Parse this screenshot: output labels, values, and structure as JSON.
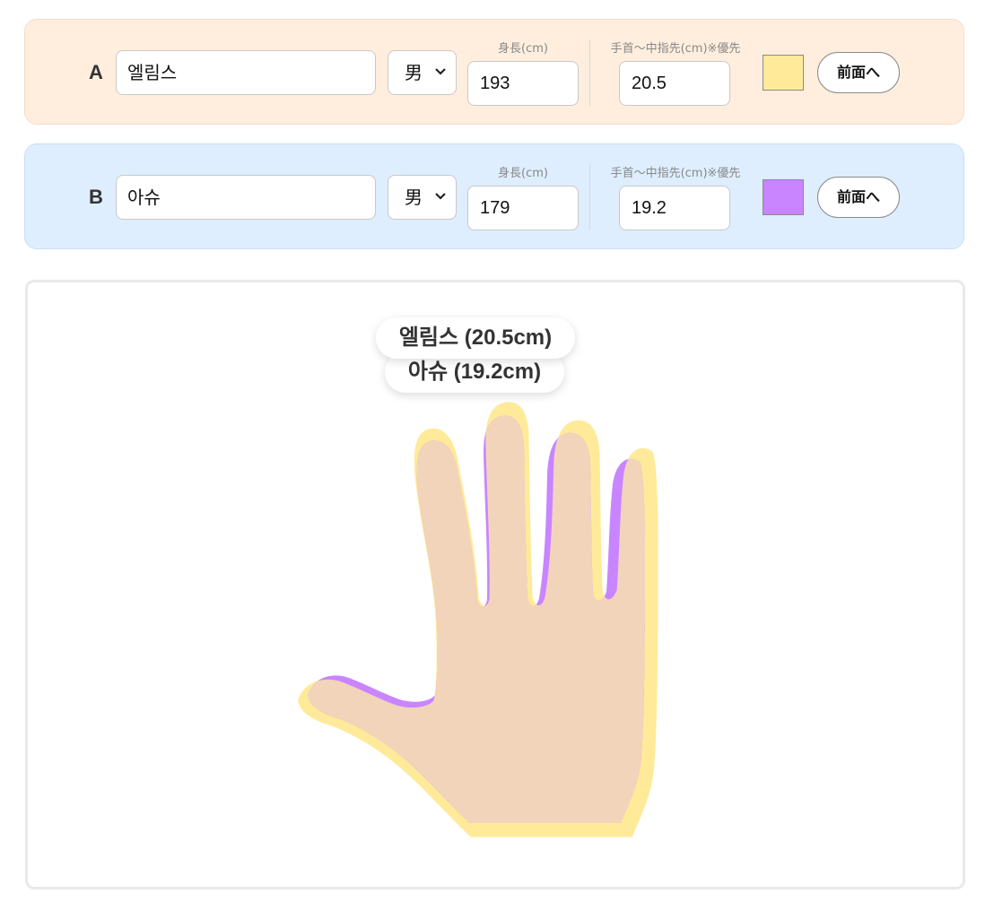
{
  "persons": {
    "a": {
      "label": "A",
      "name": "엘림스",
      "sex": "男",
      "height_caption": "身長(cm)",
      "height": "193",
      "hand_caption": "手首〜中指先(cm)※優先",
      "hand_length": "20.5",
      "color": "#FFEA99",
      "front_button": "前面へ"
    },
    "b": {
      "label": "B",
      "name": "아슈",
      "sex": "男",
      "height_caption": "身長(cm)",
      "height": "179",
      "hand_caption": "手首〜中指先(cm)※優先",
      "hand_length": "19.2",
      "color": "#C985FF",
      "front_button": "前面へ"
    }
  },
  "comparison": {
    "tag_a": "엘림스 (20.5cm)",
    "tag_b": "아슈 (19.2cm)",
    "overlap_color": "#F2D4BA"
  }
}
